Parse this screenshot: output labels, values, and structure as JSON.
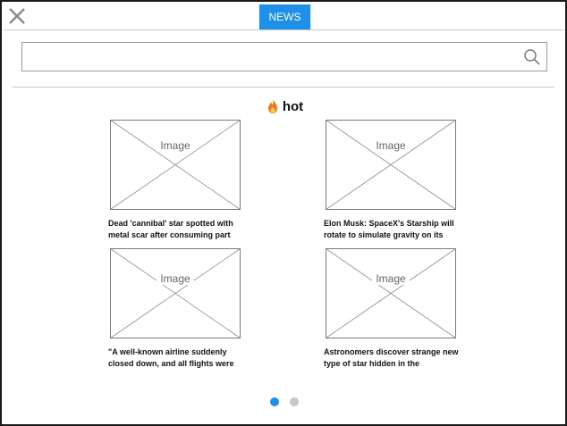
{
  "header": {
    "tab_label": "NEWS"
  },
  "search": {
    "value": "",
    "placeholder": ""
  },
  "section": {
    "heading": "hot"
  },
  "articles": [
    {
      "image_label": "Image",
      "title": "Dead 'cannibal' star spotted with metal scar after consuming part"
    },
    {
      "image_label": "Image",
      "title": "Elon Musk: SpaceX's Starship will rotate to simulate gravity on its"
    },
    {
      "image_label": "Image",
      "title": "\"A well-known airline suddenly closed down, and all flights were"
    },
    {
      "image_label": "Image",
      "title": "Astronomers discover strange new type of star hidden in the"
    }
  ],
  "pagination": {
    "total": 2,
    "active": 1
  },
  "colors": {
    "accent": "#1e90e8",
    "dot_inactive": "#c4c8ce",
    "flame": "#f07a1a"
  }
}
